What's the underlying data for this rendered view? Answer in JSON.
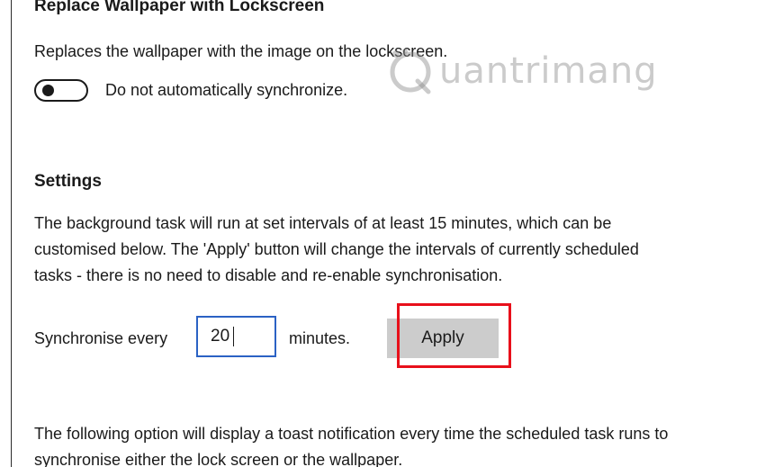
{
  "wallpaper_section": {
    "title": "Replace Wallpaper with Lockscreen",
    "description": "Replaces the wallpaper with the image on the lockscreen.",
    "toggle_label": "Do not automatically synchronize.",
    "toggle_on": false
  },
  "settings_section": {
    "title": "Settings",
    "description_lines": [
      "The background task will run at set intervals of at least 15 minutes, which can be",
      "customised below. The 'Apply' button will change the intervals of currently scheduled",
      "tasks - there is no need to disable and re-enable synchronisation."
    ],
    "interval_prefix": "Synchronise every",
    "interval_value": "20",
    "interval_suffix": "minutes.",
    "apply_label": "Apply"
  },
  "notification_section": {
    "description_lines": [
      "The following option will display a toast notification every time the scheduled task runs to",
      "synchronise either the lock screen or the wallpaper."
    ]
  },
  "watermark": {
    "text": "uantrimang",
    "icon": "quantrimang-q-logo-icon"
  },
  "colors": {
    "input_border": "#2b62c4",
    "apply_button_bg": "#cccccc",
    "highlight": "#e8101b"
  }
}
